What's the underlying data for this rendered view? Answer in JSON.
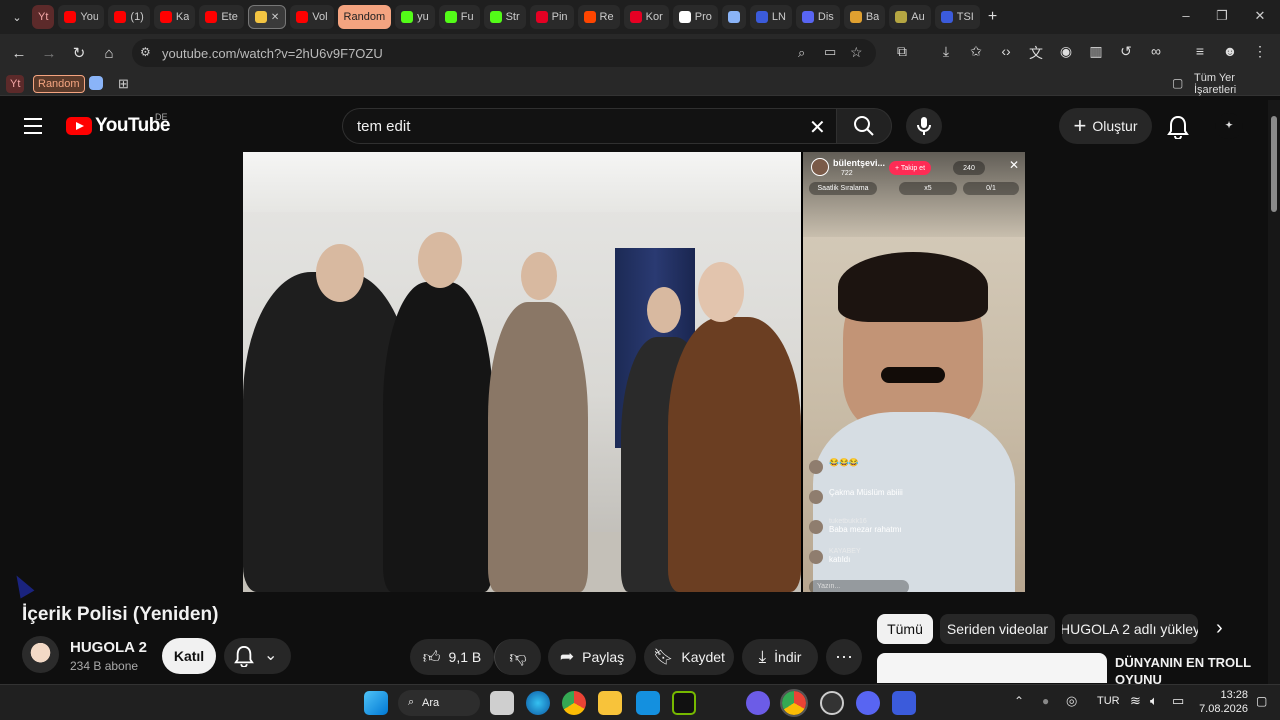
{
  "browser": {
    "tabs": [
      {
        "label": "Yt",
        "color": "#f4a7a7",
        "kind": "group"
      },
      {
        "label": "You",
        "color": "#ff0000"
      },
      {
        "label": "(1)",
        "color": "#ff0000"
      },
      {
        "label": "Ka",
        "color": "#ff0000"
      },
      {
        "label": "Ete",
        "color": "#ff0000"
      },
      {
        "label": "",
        "color": "#f4c542",
        "active": true
      },
      {
        "label": "Vol",
        "color": "#ff0000"
      },
      {
        "label": "Random",
        "color": "#f4a480",
        "kind": "group"
      },
      {
        "label": "yu",
        "color": "#53fc18"
      },
      {
        "label": "Fu",
        "color": "#53fc18"
      },
      {
        "label": "Str",
        "color": "#53fc18"
      },
      {
        "label": "Pin",
        "color": "#e60023"
      },
      {
        "label": "Re",
        "color": "#ff4500"
      },
      {
        "label": "Kor",
        "color": "#e60023"
      },
      {
        "label": "Pro",
        "color": "#ffffff"
      },
      {
        "label": "",
        "color": "#8ab4f8"
      },
      {
        "label": "LN",
        "color": "#3b5bdb"
      },
      {
        "label": "Dis",
        "color": "#5865f2"
      },
      {
        "label": "Ba",
        "color": "#e0a030"
      },
      {
        "label": "Au",
        "color": "#b5a642"
      },
      {
        "label": "TSI",
        "color": "#3b5bdb"
      }
    ],
    "url": "youtube.com/watch?v=2hU6v9F7OZU",
    "bookmarks": {
      "yt": "Yt",
      "random": "Random",
      "all": "Tüm Yer İşaretleri"
    }
  },
  "header": {
    "logo": "YouTube",
    "country": "DE",
    "search_value": "tem edit",
    "create_label": "Oluştur"
  },
  "live_overlay": {
    "user": "bülentşevi...",
    "likes": "722",
    "follow": "+ Takip et",
    "viewers": "240",
    "ranking": "Saatlik Sıralama",
    "x5": "x5",
    "count": "0/1",
    "comments": [
      {
        "name": "",
        "text": "😂😂😂"
      },
      {
        "name": "",
        "text": "Çakma Müslüm abiiii"
      },
      {
        "name": "tuketbukk16",
        "text": "Baba mezar rahatmı"
      },
      {
        "name": "KAYABEY",
        "text": "katıldı"
      }
    ],
    "input_placeholder": "Yazın..."
  },
  "video": {
    "title": "İçerik Polisi (Yeniden)",
    "channel": "HUGOLA 2",
    "subscribers": "234 B abone",
    "join_label": "Katıl",
    "like_count": "9,1 B",
    "share_label": "Paylaş",
    "save_label": "Kaydet",
    "download_label": "İndir"
  },
  "related": {
    "chips": [
      "Tümü",
      "Seriden videolar",
      "HUGOLA 2 adlı yükley"
    ],
    "first_title": "DÜNYANIN EN TROLL OYUNU"
  },
  "taskbar": {
    "search_label": "Ara",
    "lang": "TUR",
    "time": "13:28",
    "date": "7.08.2026"
  }
}
